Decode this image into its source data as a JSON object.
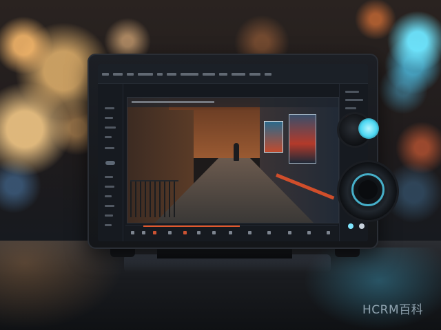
{
  "photo": {
    "subject": "monitor-with-video-editor",
    "watermark_text": "HCRM百科",
    "accent_colors": {
      "warm_bokeh": "#ffbe6e",
      "cyan_light": "#4ad7f2",
      "timeline_accent": "#e2582c"
    }
  },
  "icons": {
    "camera_knob": "camera-knob-icon",
    "lens": "lens-icon"
  }
}
